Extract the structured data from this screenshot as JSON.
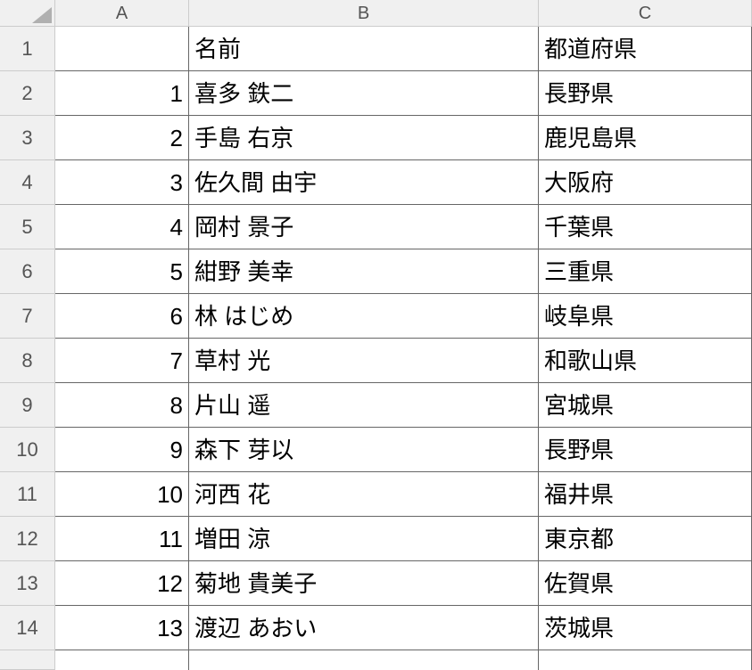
{
  "columns": [
    "A",
    "B",
    "C"
  ],
  "header_row_number": "1",
  "headers": {
    "A": "",
    "B": "名前",
    "C": "都道府県"
  },
  "rows": [
    {
      "row_number": "2",
      "A": "1",
      "B": "喜多 鉄二",
      "C": "長野県"
    },
    {
      "row_number": "3",
      "A": "2",
      "B": "手島 右京",
      "C": "鹿児島県"
    },
    {
      "row_number": "4",
      "A": "3",
      "B": "佐久間 由宇",
      "C": "大阪府"
    },
    {
      "row_number": "5",
      "A": "4",
      "B": "岡村 景子",
      "C": "千葉県"
    },
    {
      "row_number": "6",
      "A": "5",
      "B": "紺野 美幸",
      "C": "三重県"
    },
    {
      "row_number": "7",
      "A": "6",
      "B": "林 はじめ",
      "C": "岐阜県"
    },
    {
      "row_number": "8",
      "A": "7",
      "B": "草村 光",
      "C": "和歌山県"
    },
    {
      "row_number": "9",
      "A": "8",
      "B": "片山 遥",
      "C": "宮城県"
    },
    {
      "row_number": "10",
      "A": "9",
      "B": "森下 芽以",
      "C": "長野県"
    },
    {
      "row_number": "11",
      "A": "10",
      "B": "河西 花",
      "C": "福井県"
    },
    {
      "row_number": "12",
      "A": "11",
      "B": "増田 涼",
      "C": "東京都"
    },
    {
      "row_number": "13",
      "A": "12",
      "B": "菊地 貴美子",
      "C": "佐賀県"
    },
    {
      "row_number": "14",
      "A": "13",
      "B": "渡辺 あおい",
      "C": "茨城県"
    }
  ],
  "partial_row": {
    "A": "",
    "B": "",
    "C": ""
  }
}
